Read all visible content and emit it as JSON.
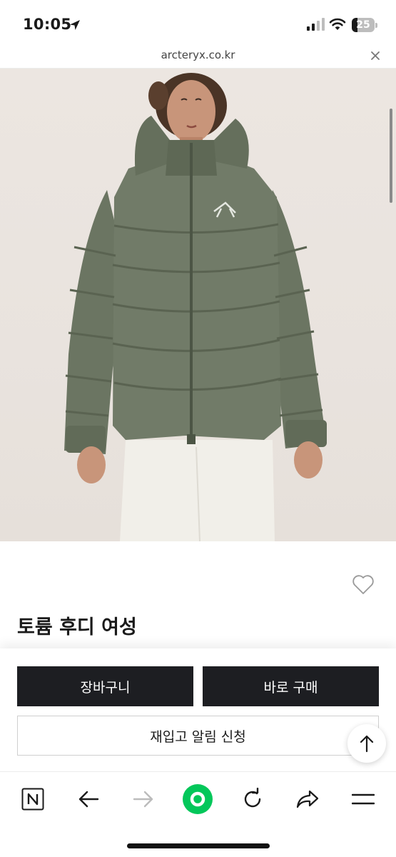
{
  "status_bar": {
    "time": "10:05",
    "battery_level": "25",
    "battery_fraction": 0.25,
    "icons": [
      "location-arrow-icon",
      "cellular-signal-icon",
      "wifi-icon",
      "battery-icon"
    ]
  },
  "browser": {
    "url": "arcteryx.co.kr",
    "close_icon": "close-icon"
  },
  "product": {
    "title": "토륨 후디 여성",
    "image_alt": "product-photo",
    "wishlist_icon": "heart-outline-icon"
  },
  "actions": {
    "cart_label": "장바구니",
    "buy_label": "바로 구매",
    "notify_label": "재입고 알림 신청",
    "scroll_top_icon": "arrow-up-icon"
  },
  "toolbar": {
    "items": [
      "naver-n-icon",
      "back-arrow-icon",
      "forward-arrow-icon",
      "green-dot-icon",
      "refresh-icon",
      "share-icon",
      "menu-icon"
    ]
  },
  "colors": {
    "button_dark": "#1d1e22",
    "jacket_green": "#6b7562",
    "accent_green": "#03c75a",
    "background_beige": "#e9e3de"
  }
}
